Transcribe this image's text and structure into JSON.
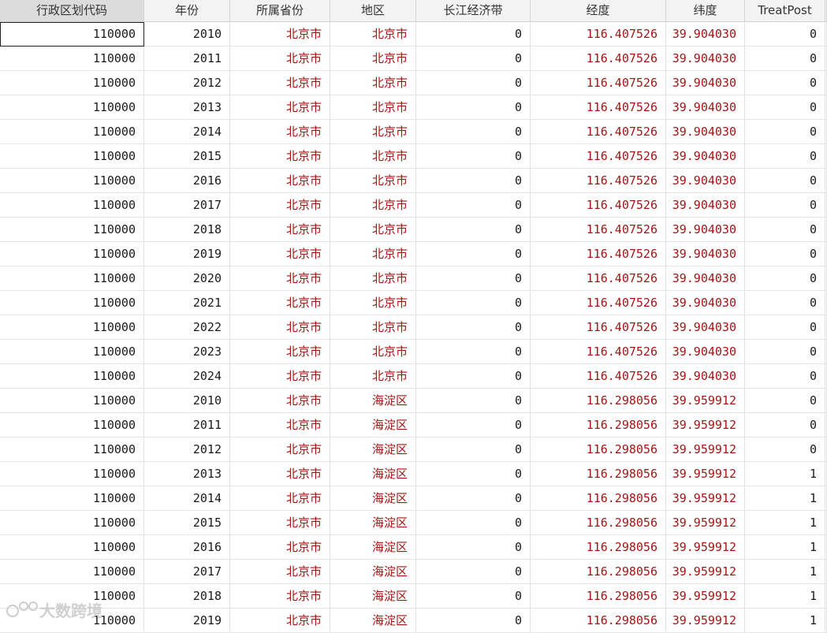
{
  "columns": [
    "行政区划代码",
    "年份",
    "所属省份",
    "地区",
    "长江经济带",
    "经度",
    "纬度",
    "TreatPost"
  ],
  "rows": [
    [
      "110000",
      "2010",
      "北京市",
      "北京市",
      "0",
      "116.407526",
      "39.904030",
      "0"
    ],
    [
      "110000",
      "2011",
      "北京市",
      "北京市",
      "0",
      "116.407526",
      "39.904030",
      "0"
    ],
    [
      "110000",
      "2012",
      "北京市",
      "北京市",
      "0",
      "116.407526",
      "39.904030",
      "0"
    ],
    [
      "110000",
      "2013",
      "北京市",
      "北京市",
      "0",
      "116.407526",
      "39.904030",
      "0"
    ],
    [
      "110000",
      "2014",
      "北京市",
      "北京市",
      "0",
      "116.407526",
      "39.904030",
      "0"
    ],
    [
      "110000",
      "2015",
      "北京市",
      "北京市",
      "0",
      "116.407526",
      "39.904030",
      "0"
    ],
    [
      "110000",
      "2016",
      "北京市",
      "北京市",
      "0",
      "116.407526",
      "39.904030",
      "0"
    ],
    [
      "110000",
      "2017",
      "北京市",
      "北京市",
      "0",
      "116.407526",
      "39.904030",
      "0"
    ],
    [
      "110000",
      "2018",
      "北京市",
      "北京市",
      "0",
      "116.407526",
      "39.904030",
      "0"
    ],
    [
      "110000",
      "2019",
      "北京市",
      "北京市",
      "0",
      "116.407526",
      "39.904030",
      "0"
    ],
    [
      "110000",
      "2020",
      "北京市",
      "北京市",
      "0",
      "116.407526",
      "39.904030",
      "0"
    ],
    [
      "110000",
      "2021",
      "北京市",
      "北京市",
      "0",
      "116.407526",
      "39.904030",
      "0"
    ],
    [
      "110000",
      "2022",
      "北京市",
      "北京市",
      "0",
      "116.407526",
      "39.904030",
      "0"
    ],
    [
      "110000",
      "2023",
      "北京市",
      "北京市",
      "0",
      "116.407526",
      "39.904030",
      "0"
    ],
    [
      "110000",
      "2024",
      "北京市",
      "北京市",
      "0",
      "116.407526",
      "39.904030",
      "0"
    ],
    [
      "110000",
      "2010",
      "北京市",
      "海淀区",
      "0",
      "116.298056",
      "39.959912",
      "0"
    ],
    [
      "110000",
      "2011",
      "北京市",
      "海淀区",
      "0",
      "116.298056",
      "39.959912",
      "0"
    ],
    [
      "110000",
      "2012",
      "北京市",
      "海淀区",
      "0",
      "116.298056",
      "39.959912",
      "0"
    ],
    [
      "110000",
      "2013",
      "北京市",
      "海淀区",
      "0",
      "116.298056",
      "39.959912",
      "1"
    ],
    [
      "110000",
      "2014",
      "北京市",
      "海淀区",
      "0",
      "116.298056",
      "39.959912",
      "1"
    ],
    [
      "110000",
      "2015",
      "北京市",
      "海淀区",
      "0",
      "116.298056",
      "39.959912",
      "1"
    ],
    [
      "110000",
      "2016",
      "北京市",
      "海淀区",
      "0",
      "116.298056",
      "39.959912",
      "1"
    ],
    [
      "110000",
      "2017",
      "北京市",
      "海淀区",
      "0",
      "116.298056",
      "39.959912",
      "1"
    ],
    [
      "110000",
      "2018",
      "北京市",
      "海淀区",
      "0",
      "116.298056",
      "39.959912",
      "1"
    ],
    [
      "110000",
      "2019",
      "北京市",
      "海淀区",
      "0",
      "116.298056",
      "39.959912",
      "1"
    ]
  ],
  "column_types": [
    "num",
    "num",
    "str",
    "str",
    "num",
    "dec",
    "dec",
    "num"
  ],
  "colors": {
    "string_value": "#a31515",
    "numeric_value": "#1a1a1a",
    "header_bg": "#f3f3f3"
  },
  "watermark": {
    "text": "大数跨境"
  }
}
